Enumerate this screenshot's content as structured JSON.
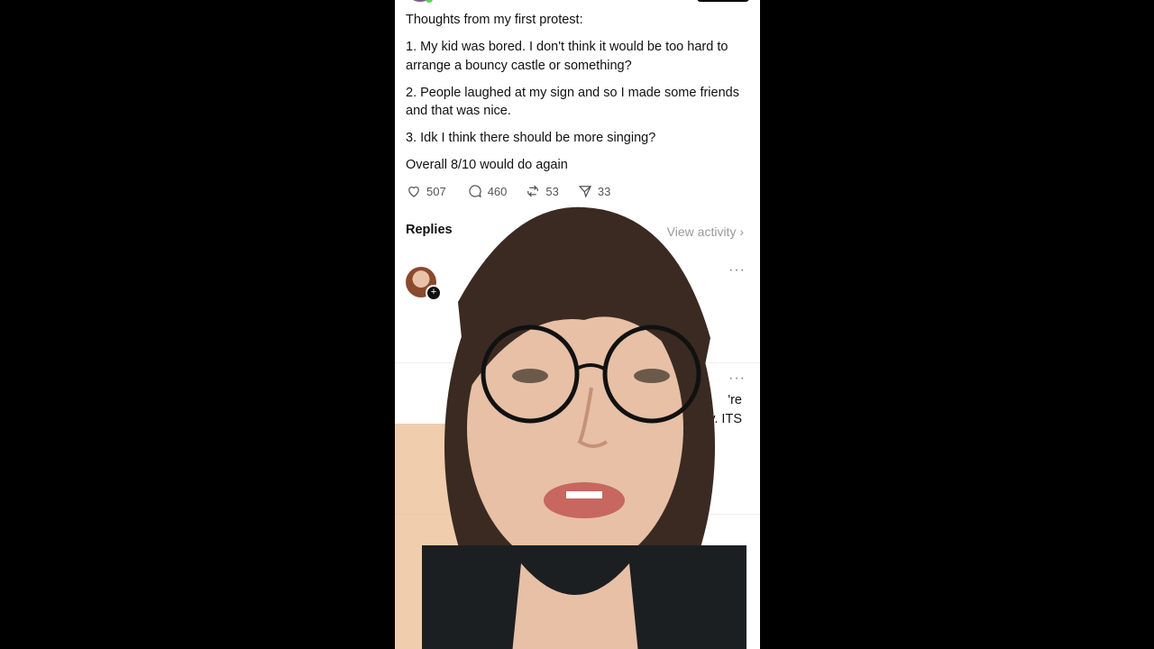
{
  "post": {
    "lines": [
      "Thoughts from my first protest:",
      "1. My kid was bored. I don't think it would be too hard to arrange a bouncy castle or something?",
      "2. People laughed at my sign and so I made some friends and that was nice.",
      "3. Idk I think there should be more singing?",
      "Overall 8/10 would do again"
    ]
  },
  "actions": {
    "likes": "507",
    "comments": "460",
    "reposts": "53",
    "shares": "33"
  },
  "replies": {
    "heading": "Replies",
    "view_activity": "View activity ›",
    "reply_fragment_1": "'re",
    "reply_fragment_2": "ty. ITS"
  },
  "icons": [
    "heart-icon",
    "comment-icon",
    "repost-icon",
    "share-icon",
    "more-icon",
    "plus-icon"
  ]
}
